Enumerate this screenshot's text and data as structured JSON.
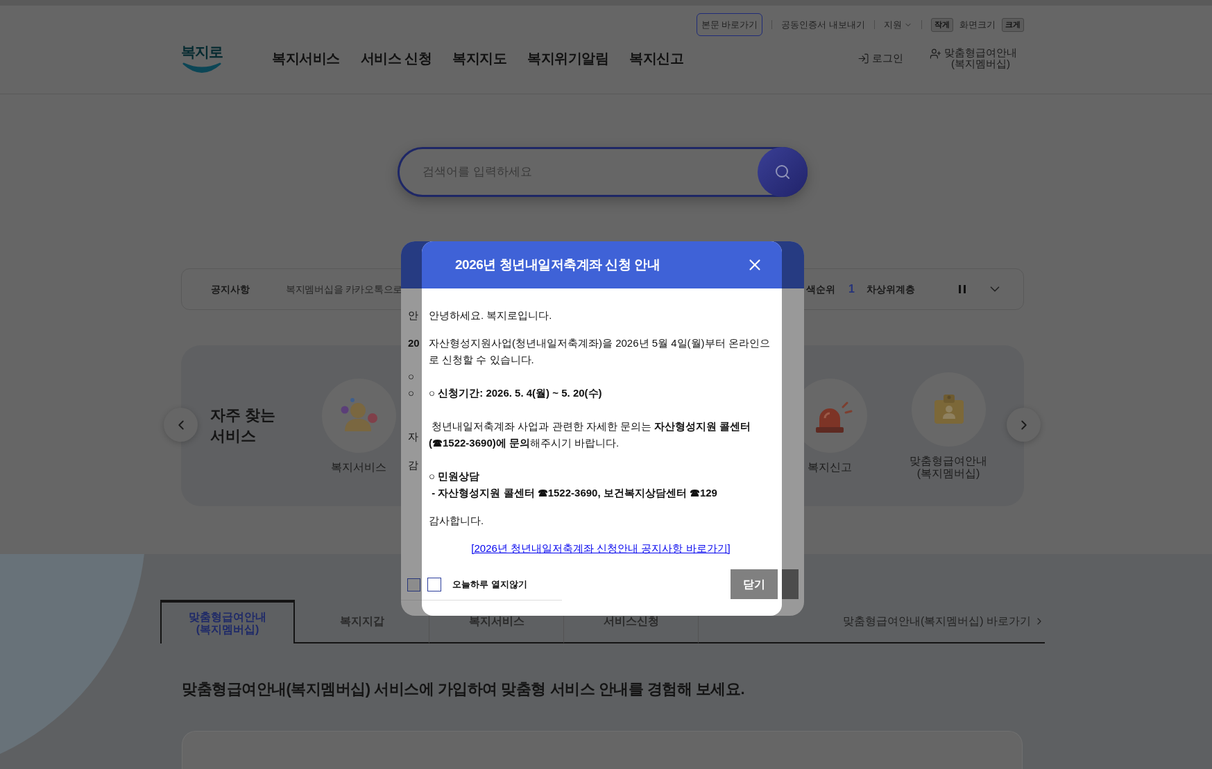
{
  "header": {
    "utility_links": [
      {
        "kind": "button",
        "label": "본문 바로가기"
      },
      {
        "kind": "link",
        "label": "공동인증서 내보내기"
      },
      {
        "kind": "dropdown",
        "label": "지원"
      }
    ],
    "font_size": {
      "smaller": "작게",
      "label": "화면크기",
      "larger": "크게"
    },
    "logo": "복지로",
    "nav": [
      "복지서비스",
      "서비스 신청",
      "복지지도",
      "복지위기알림",
      "복지신고"
    ],
    "login": "로그인",
    "membership": "맞춤형급여안내\n(복지멤버십)"
  },
  "search": {
    "placeholder": "검색어를 입력하세요"
  },
  "notice_bar": {
    "label": "공지사항",
    "notice": "복지멤버십을 카카오톡으로",
    "ranking_label": "색순위",
    "rank": "1",
    "ranked_term": "차상위계층"
  },
  "frequent_services": {
    "title": "자주 찾는\n서비스",
    "items": [
      {
        "kind": "people",
        "label": "복지서비스"
      },
      {
        "kind": "siren",
        "label": "복지신고"
      },
      {
        "kind": "badge",
        "label": "맞춤형급여안내\n(복지멤버십)"
      }
    ]
  },
  "tabs": [
    {
      "label": "맞춤형급여안내\n(복지멤버십)",
      "selected": true
    },
    {
      "label": "복지지갑",
      "selected": false
    },
    {
      "label": "복지서비스",
      "selected": false
    },
    {
      "label": "서비스신청",
      "selected": false
    }
  ],
  "tab_link": "맞춤형급여안내(복지멤버십) 바로가기",
  "section_heading": "맞춤형급여안내(복지멤버십) 서비스에 가입하여 맞춤형 서비스 안내를 경험해 보세요.",
  "background_dialog": {
    "fragments": [
      {
        "text": "안",
        "bold": false
      },
      {
        "text": "20",
        "bold": true
      },
      {
        "text": "○"
      },
      {
        "text": "○"
      },
      {
        "text": "자",
        "bold": false
      },
      {
        "text": "감",
        "bold": false
      }
    ],
    "dont_show_today_checked": false
  },
  "dialog": {
    "title": "2026년 청년내일저축계좌 신청 안내",
    "blocks": [
      {
        "kind": "paragraph",
        "text": "안녕하세요. 복지로입니다."
      },
      {
        "kind": "paragraph",
        "text": "자산형성지원사업(청년내일저축계좌)을 2026년 5월 4일(월)부터 온라인으로 신청할 수 있습니다."
      },
      {
        "kind": "heading",
        "text": "○ 신청기간: 2026. 5. 4(월) ~ 5. 20(수)"
      },
      {
        "kind": "paragraph",
        "text": " 청년내일저축계좌 사업과 관련한 자세한 문의는 **자산형성지원 콜센터 (☎1522-3690)에 문의**해주시기 바랍니다."
      },
      {
        "kind": "heading",
        "text": "○ 민원상담"
      },
      {
        "kind": "detail",
        "text": " - 자산형성지원 콜센터 ☎1522-3690, 보건복지상담센터 ☎129"
      },
      {
        "kind": "paragraph",
        "text": "감사합니다."
      },
      {
        "kind": "link",
        "text": "[2026년 청년내일저축계좌 신청안내 공지사항 바로가기]"
      }
    ],
    "dont_show_today": {
      "label": "오늘하루 열지않기",
      "checked": false
    },
    "close_button": "닫기"
  }
}
